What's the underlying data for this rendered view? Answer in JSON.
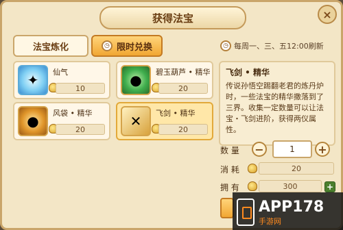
{
  "header": {
    "title": "获得法宝",
    "close_label": "×"
  },
  "tabs": [
    {
      "label": "法宝炼化",
      "active": false
    },
    {
      "label": "限时兑换",
      "active": true
    }
  ],
  "refresh_text": "每周一、三、五12:00刷新",
  "items": [
    {
      "name": "仙气",
      "cost": "10",
      "icon": "sparkle-orb",
      "selected": false
    },
    {
      "name": "碧玉葫芦 • 精华",
      "cost": "20",
      "icon": "green-gourd",
      "selected": false
    },
    {
      "name": "风袋 • 精华",
      "cost": "20",
      "icon": "wind-bag",
      "selected": false
    },
    {
      "name": "飞剑 • 精华",
      "cost": "20",
      "icon": "flying-sword",
      "selected": true
    }
  ],
  "detail": {
    "title": "飞剑 • 精华",
    "text": "传说孙悟空踢翻老君的炼丹炉时，一些法宝的精华撒落到了三界。收集一定数量可以让法宝・飞剑进阶，获得两仪属性。"
  },
  "quantity": {
    "label": "数 量",
    "value": "1",
    "minus": "−",
    "plus": "+"
  },
  "consume": {
    "label": "消 耗",
    "value": "20"
  },
  "owned": {
    "label": "拥 有",
    "value": "300",
    "add": "+"
  },
  "watermark": {
    "text": "APP178",
    "sub": "手游网"
  }
}
